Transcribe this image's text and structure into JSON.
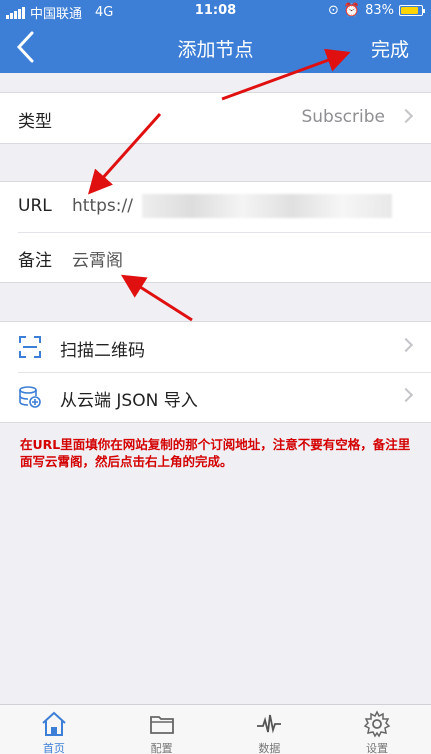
{
  "status": {
    "carrier": "中国联通",
    "network": "4G",
    "time": "11:08",
    "battery": "83%",
    "battery_level": 0.83
  },
  "nav": {
    "title": "添加节点",
    "done_label": "完成",
    "accent": "#3d7fd6"
  },
  "type_row": {
    "label": "类型",
    "value": "Subscribe"
  },
  "url_row": {
    "label": "URL",
    "value": "https://"
  },
  "note_row": {
    "label": "备注",
    "value": "云霄阁"
  },
  "actions": [
    {
      "label": "扫描二维码",
      "icon": "scan-icon"
    },
    {
      "label": "从云端 JSON 导入",
      "icon": "database-icon"
    }
  ],
  "instruction": "在URL里面填你在网站复制的那个订阅地址，注意不要有空格，备注里面写云霄阁，然后点击右上角的完成。",
  "instruction_color": "#d40000",
  "tabs": [
    {
      "label": "首页",
      "icon": "home-icon",
      "active": true
    },
    {
      "label": "配置",
      "icon": "folder-icon",
      "active": false
    },
    {
      "label": "数据",
      "icon": "pulse-icon",
      "active": false
    },
    {
      "label": "设置",
      "icon": "gear-icon",
      "active": false
    }
  ]
}
